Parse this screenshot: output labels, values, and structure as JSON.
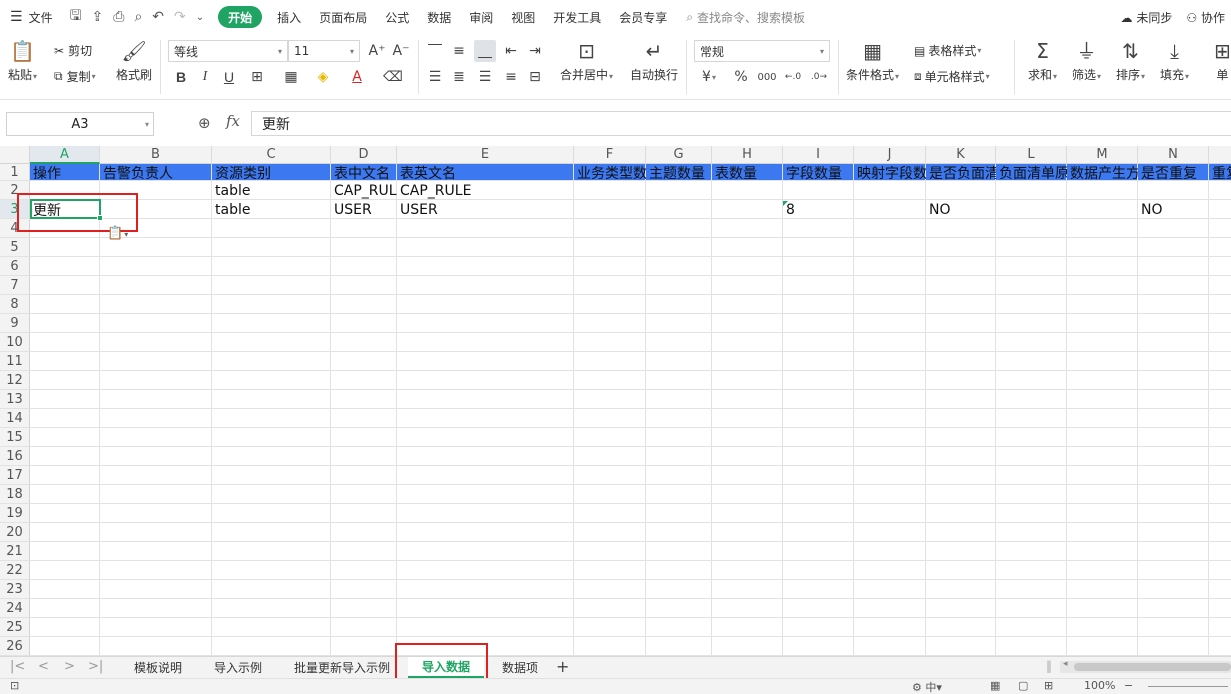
{
  "menubar": {
    "file_label": "文件",
    "tabs": [
      "开始",
      "插入",
      "页面布局",
      "公式",
      "数据",
      "审阅",
      "视图",
      "开发工具",
      "会员专享"
    ],
    "active_tab": "开始",
    "search_placeholder": "查找命令、搜索模板",
    "sync_label": "未同步",
    "collab_label": "协作"
  },
  "ribbon": {
    "paste": "粘贴",
    "cut": "剪切",
    "copy": "复制",
    "format_painter": "格式刷",
    "font_name": "等线",
    "font_size": "11",
    "bold": "B",
    "italic": "I",
    "underline": "U",
    "merge_center": "合并居中",
    "wrap_text": "自动换行",
    "number_format": "常规",
    "currency": "¥",
    "percent": "%",
    "thousands": "000",
    "conditional_format": "条件格式",
    "table_style": "表格样式",
    "cell_style": "单元格样式",
    "sum": "求和",
    "filter": "筛选",
    "sort": "排序",
    "fill": "填充",
    "cell_partial": "单"
  },
  "formula_bar": {
    "name_box": "A3",
    "fx": "fx",
    "content": "更新"
  },
  "grid": {
    "columns": [
      "A",
      "B",
      "C",
      "D",
      "E",
      "F",
      "G",
      "H",
      "I",
      "J",
      "K",
      "L",
      "M",
      "N"
    ],
    "rows": [
      "1",
      "2",
      "3",
      "4",
      "5",
      "6",
      "7",
      "8",
      "9",
      "10",
      "11",
      "12",
      "13",
      "14",
      "15",
      "16",
      "17",
      "18",
      "19",
      "20",
      "21",
      "22",
      "23",
      "24",
      "25",
      "26"
    ],
    "header_row": [
      "操作",
      "告警负责人",
      "资源类别",
      "表中文名",
      "表英文名",
      "业务类型数",
      "主题数量",
      "表数量",
      "字段数量",
      "映射字段数",
      "是否负面清",
      "负面清单原",
      "数据产生方",
      "是否重复",
      "重复"
    ],
    "row2": [
      "",
      "",
      "table",
      "CAP_RULE",
      "CAP_RULE"
    ],
    "row3": {
      "A": "更新",
      "C": "table",
      "D": "USER",
      "E": "USER",
      "I": "8",
      "K": "NO",
      "N": "NO"
    }
  },
  "sheets": {
    "tabs": [
      "模板说明",
      "导入示例",
      "批量更新导入示例",
      "导入数据",
      "数据项"
    ],
    "active": "导入数据"
  },
  "status": {
    "zoom": "100%"
  },
  "colors": {
    "accent": "#1fa463",
    "header_band": "#3c78f0",
    "highlight_box": "#e02020"
  }
}
